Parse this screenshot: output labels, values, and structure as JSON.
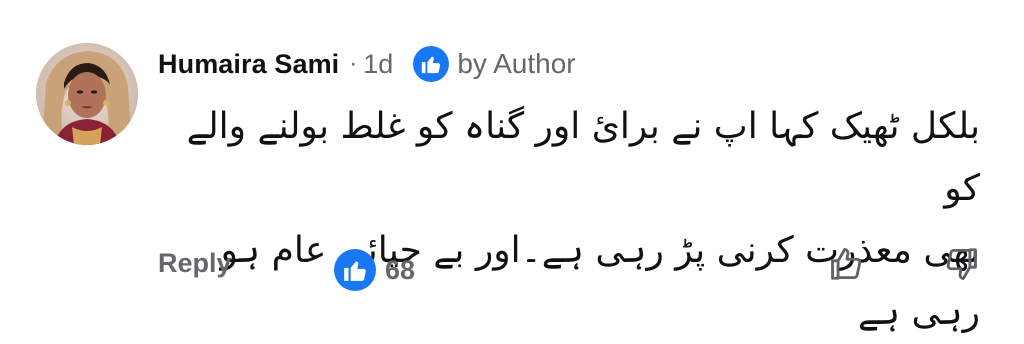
{
  "comment": {
    "author_name": "Humaira Sami",
    "separator": "·",
    "time": "1d",
    "author_badge_label": "by Author",
    "text_line_1": "بلکل ٹھیک کہا اپ نے برائ اور گناہ کو غلط بولنے والے کو",
    "text_line_2": "بھی معذرت کرنی پڑ رہی ہے۔اور بے حیائی عام ہو رہی ہے",
    "reply_label": "Reply",
    "reaction_count": "68"
  },
  "icons": {
    "avatar": "avatar-photo",
    "author_badge": "like-icon",
    "reaction": "like-icon",
    "like_button": "thumbs-up-outline-icon",
    "dislike_button": "thumbs-down-outline-icon"
  },
  "colors": {
    "accent": "#1877f2",
    "muted_text": "#65676b",
    "primary_text": "#111111",
    "background": "#ffffff"
  }
}
